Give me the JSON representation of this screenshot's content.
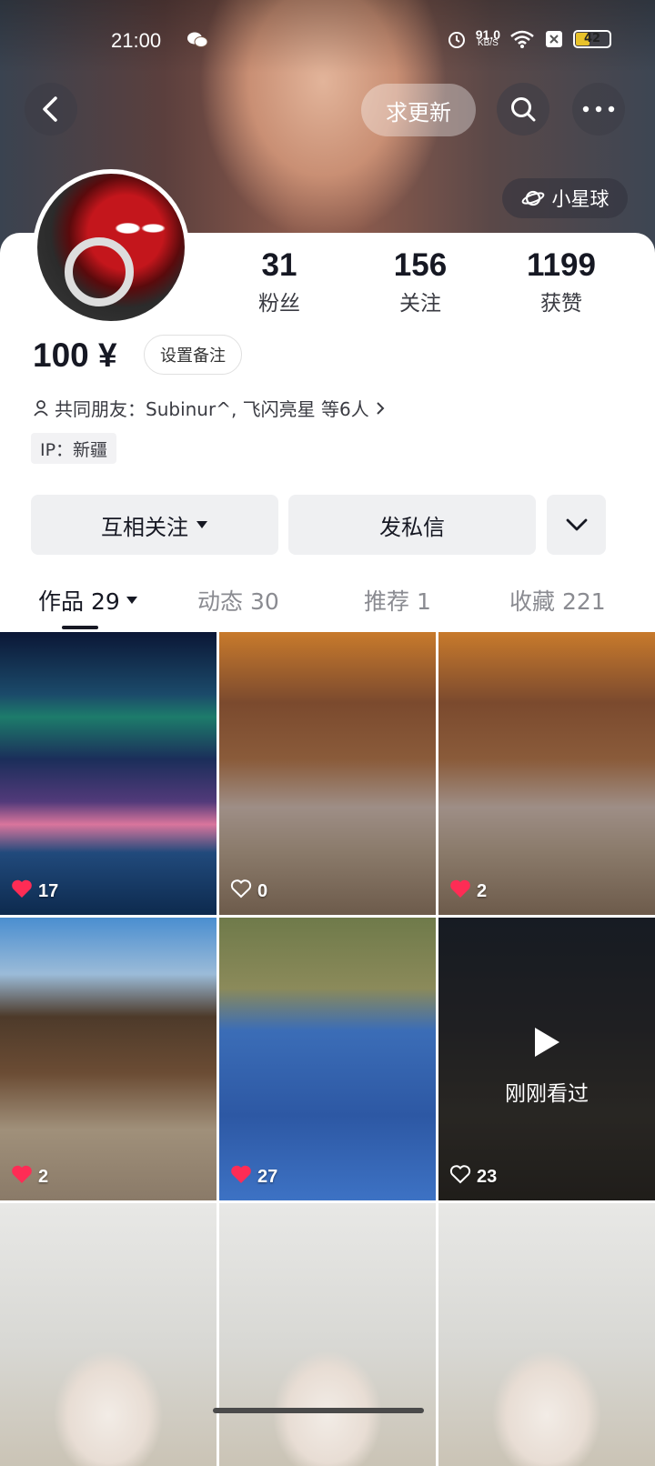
{
  "status_bar": {
    "time": "21:00",
    "speed_value": "91.0",
    "speed_unit": "KB/S",
    "battery": "42",
    "battery_level": 0.42,
    "icons": [
      "wechat-icon",
      "alarm-icon",
      "wifi-icon",
      "sim-off-icon",
      "battery-icon"
    ]
  },
  "header": {
    "back_icon": "back-arrow-icon",
    "request_update_label": "求更新",
    "search_icon": "search-icon",
    "more_icon": "more-icon",
    "planet_label": "小星球"
  },
  "profile": {
    "name": "100 ¥",
    "set_remark_label": "设置备注",
    "stats": [
      {
        "value": "31",
        "label": "粉丝"
      },
      {
        "value": "156",
        "label": "关注"
      },
      {
        "value": "1199",
        "label": "获赞"
      }
    ],
    "mutual_friends": "共同朋友：Subinur^, 飞闪亮星 等6人",
    "ip": "IP：新疆"
  },
  "actions": {
    "follow_label": "互相关注",
    "message_label": "发私信"
  },
  "tabs": [
    {
      "label": "作品 29",
      "active": true
    },
    {
      "label": "动态 30"
    },
    {
      "label": "推荐 1"
    },
    {
      "label": "收藏 221"
    }
  ],
  "videos": [
    {
      "likes": "17",
      "liked": true
    },
    {
      "likes": "0",
      "liked": false
    },
    {
      "likes": "2",
      "liked": true
    },
    {
      "likes": "2",
      "liked": true
    },
    {
      "likes": "27",
      "liked": true
    },
    {
      "likes": "23",
      "liked": false,
      "watched_label": "刚刚看过"
    },
    {
      "likes": ""
    },
    {
      "likes": ""
    },
    {
      "likes": ""
    }
  ],
  "colors": {
    "like_red": "#fe2c55",
    "text_primary": "#161823",
    "button_bg": "#eff0f2"
  }
}
